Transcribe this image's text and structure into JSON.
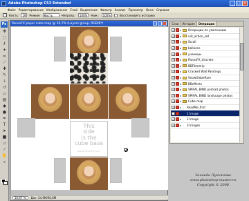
{
  "app": {
    "title": "Adobe Photoshop CS3 Extended"
  },
  "window_buttons": {
    "minimize": "_",
    "maximize": "□",
    "close": "×"
  },
  "menu": [
    "Файл",
    "Редактирование",
    "Изображение",
    "Слой",
    "Выделение",
    "Фильтр",
    "Анализ",
    "Просмотр",
    "Окно",
    "Справка"
  ],
  "options_bar": {
    "brush_label": "Кисть:",
    "brush_size": "19",
    "mode_label": "Режим:",
    "mode_value": "Кисть",
    "opacity_label": "Непрозр.:",
    "opacity_value": "100%",
    "flow_label": "Наж.:",
    "flow_value": "100%",
    "history_label": "Восстановить историю"
  },
  "document": {
    "title": "PanosFX paper cube map @ 16,7% (Layers group, RGB/8*)",
    "base_text": [
      "This",
      "side",
      "is the",
      "cube base"
    ],
    "base_url": "www.PanosFX.com",
    "zoom": "16,67 %",
    "doc_info": "Док: 24,9М/60,6М"
  },
  "panel": {
    "tabs": [
      "Слои",
      "История",
      "Операции"
    ],
    "active_tab": 2,
    "rows": [
      {
        "label": "Операции по умолчанию",
        "level": 0
      },
      {
        "label": "niit_action_set",
        "level": 0
      },
      {
        "label": "Scroll",
        "level": 0
      },
      {
        "label": "balloons",
        "level": 0
      },
      {
        "label": "ученицы",
        "level": 0
      },
      {
        "label": "PanosFX_discrete",
        "level": 0
      },
      {
        "label": "BBFilmstrip",
        "level": 0
      },
      {
        "label": "Cracked Wall Paintings",
        "level": 0
      },
      {
        "label": "SnowGlobeRam",
        "level": 0
      },
      {
        "label": "BBeffects",
        "level": 0
      },
      {
        "label": "SPIRAL BIND portrait photos",
        "level": 0
      },
      {
        "label": "SPIRAL BIND landscape photos",
        "level": 0
      },
      {
        "label": "Cube map",
        "level": 0
      },
      {
        "label": "ReadMe_first",
        "level": 1
      },
      {
        "label": "1 Image",
        "level": 1,
        "selected": true
      },
      {
        "label": "2 Image",
        "level": 1
      },
      {
        "label": "3 Images",
        "level": 1
      }
    ]
  },
  "signature": [
    "Зинаида Лукьянова",
    "www.photoshop-master.ru",
    "Copyright © 2008"
  ],
  "colors": {
    "titlebar": "#2453b8",
    "selection": "#0a246a",
    "action_box": "#d43c2a"
  }
}
